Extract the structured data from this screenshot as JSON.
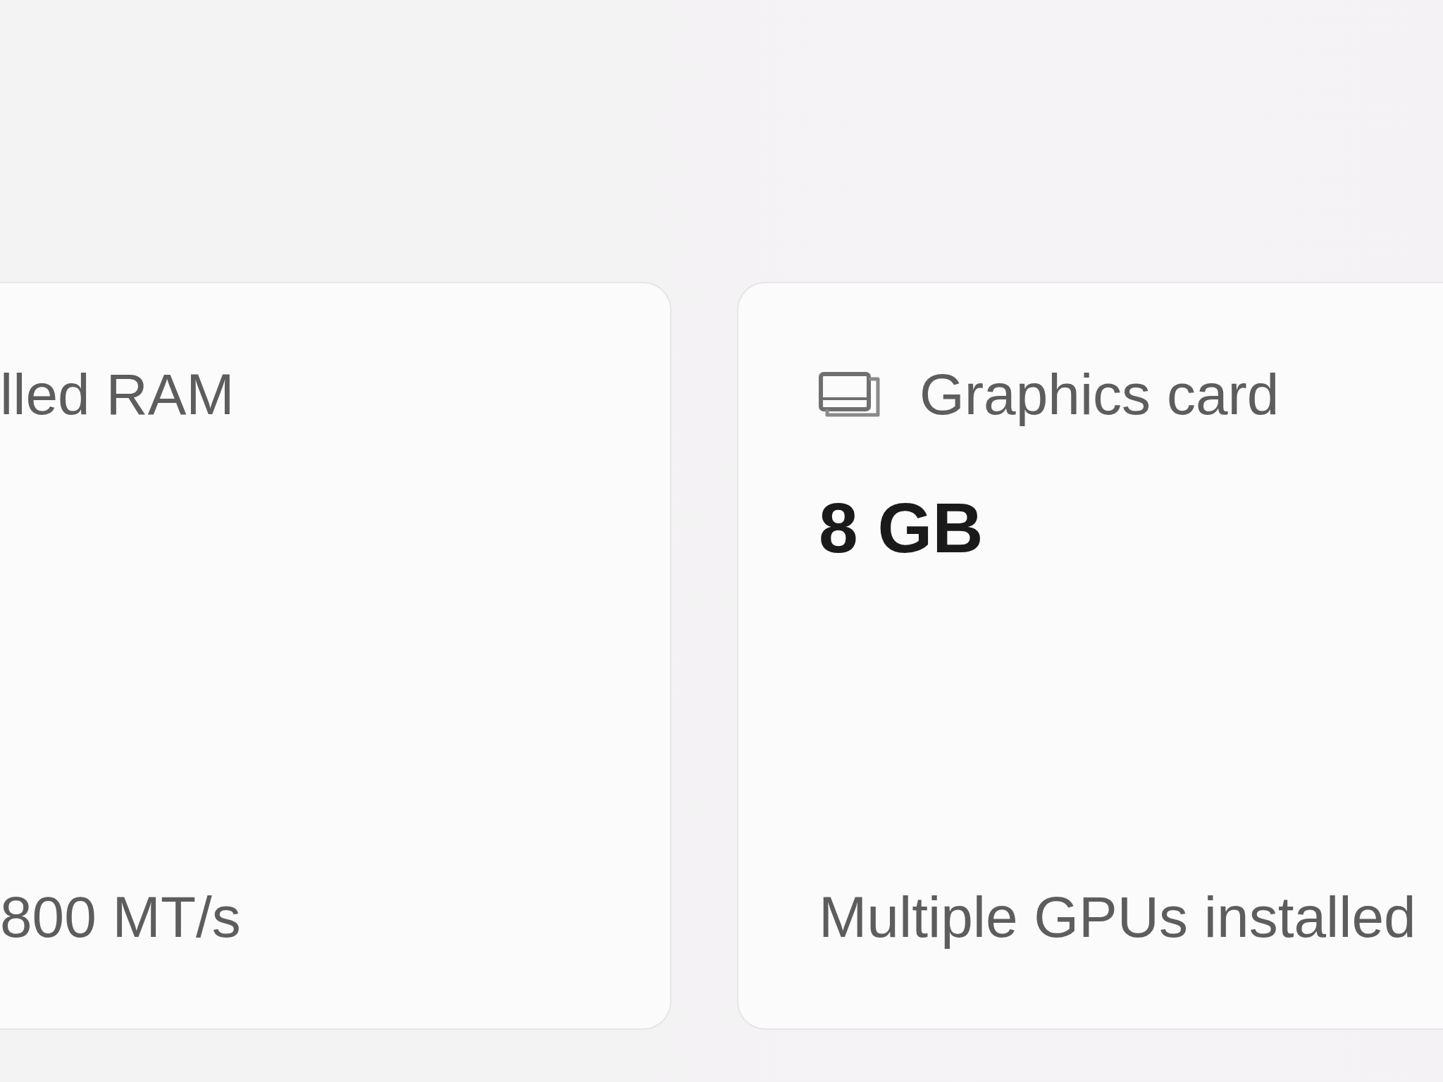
{
  "cards": [
    {
      "kind": "left_cut",
      "label": "lled RAM",
      "footer": "800 MT/s"
    },
    {
      "kind": "right_cut",
      "label": "Graphics card",
      "value": "8 GB",
      "footer": "Multiple GPUs installed"
    }
  ]
}
